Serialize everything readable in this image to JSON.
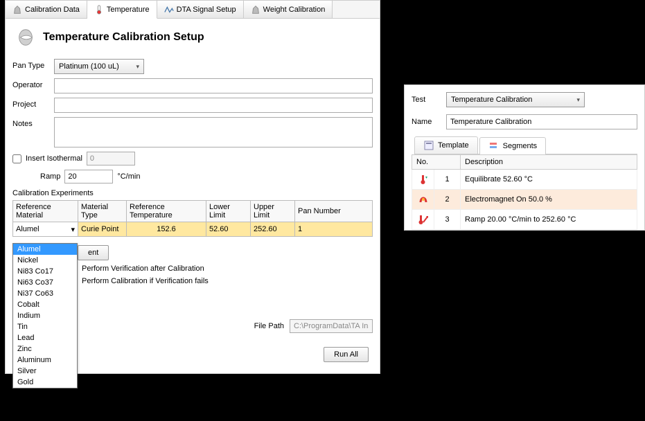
{
  "tabs": {
    "calibration_data": "Calibration Data",
    "temperature": "Temperature",
    "dta_signal": "DTA Signal Setup",
    "weight_cal": "Weight Calibration"
  },
  "header": {
    "title": "Temperature Calibration Setup"
  },
  "form": {
    "pan_type_label": "Pan Type",
    "pan_type_value": "Platinum (100 uL)",
    "operator_label": "Operator",
    "operator_value": "",
    "project_label": "Project",
    "project_value": "",
    "notes_label": "Notes",
    "notes_value": "",
    "insert_iso_label": "Insert Isothermal",
    "insert_iso_value": "0",
    "ramp_label": "Ramp",
    "ramp_value": "20",
    "ramp_unit": "°C/min",
    "cal_exp_label": "Calibration Experiments"
  },
  "table": {
    "headers": {
      "ref_mat": "Reference Material",
      "mat_type": "Material Type",
      "ref_temp": "Reference Temperature",
      "lower": "Lower Limit",
      "upper": "Upper Limit",
      "pan": "Pan Number"
    },
    "row": {
      "ref_mat": "Alumel",
      "mat_type": "Curie Point",
      "ref_temp": "152.6",
      "lower": "52.60",
      "upper": "252.60",
      "pan": "1"
    }
  },
  "ref_mat_options": [
    "Alumel",
    "Nickel",
    "Ni83 Co17",
    "Ni63 Co37",
    "Ni37 Co63",
    "Cobalt",
    "Indium",
    "Tin",
    "Lead",
    "Zinc",
    "Aluminum",
    "Silver",
    "Gold"
  ],
  "buttons": {
    "add_experiment": "ent",
    "run_all": "Run All"
  },
  "post_opts": {
    "verify_after": "Perform Verification after Calibration",
    "cal_if_fail": "Perform Calibration if Verification fails"
  },
  "filepath": {
    "label": "File Path",
    "value": "C:\\ProgramData\\TA Instr"
  },
  "right": {
    "test_label": "Test",
    "test_value": "Temperature Calibration",
    "name_label": "Name",
    "name_value": "Temperature Calibration",
    "tabs": {
      "template": "Template",
      "segments": "Segments"
    },
    "seg_headers": {
      "no": "No.",
      "desc": "Description"
    },
    "segments": [
      {
        "n": "1",
        "desc": "Equilibrate 52.60 °C"
      },
      {
        "n": "2",
        "desc": "Electromagnet On 50.0 %"
      },
      {
        "n": "3",
        "desc": "Ramp 20.00 °C/min to 252.60 °C"
      }
    ]
  }
}
